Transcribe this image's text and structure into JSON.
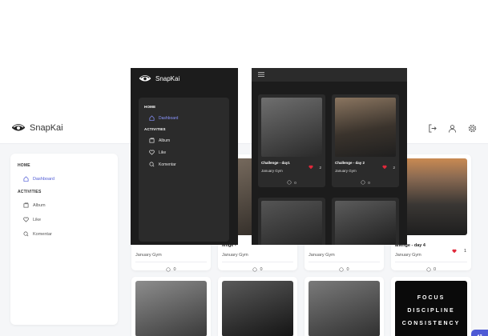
{
  "app": {
    "brand": "SnapKai"
  },
  "sidebar": {
    "home_label": "HOME",
    "dashboard_label": "Dashboard",
    "activities_label": "ACTIVITIES",
    "items": [
      {
        "label": "Album",
        "icon": "album-icon"
      },
      {
        "label": "Like",
        "icon": "heart-icon"
      },
      {
        "label": "Komentar",
        "icon": "comment-icon"
      }
    ]
  },
  "topbar_icons": [
    "logout-icon",
    "user-icon",
    "gear-icon"
  ],
  "posts": [
    {
      "title": "Challenge - day1",
      "author": "January Gym",
      "likes": "2",
      "comments": "0"
    },
    {
      "title": "Challenge - day 2",
      "author": "January Gym",
      "likes": "2",
      "comments": "0"
    },
    {
      "title": "Challenge - day 3",
      "author": "January Gym",
      "likes": "2",
      "comments": "0"
    },
    {
      "title": "Challenge - day 4",
      "author": "January Gym",
      "likes": "1",
      "comments": "0"
    }
  ],
  "visible_titles": {
    "card1": "lenge - ",
    "card4": "allenge - day 4"
  },
  "focus_tile": [
    "FOCUS",
    "DISCIPLINE",
    "CONSISTENCY"
  ],
  "colors": {
    "accent": "#4f5bd5",
    "heart": "#e0283a",
    "dark_bg": "#1c1c1c",
    "dark_panel": "#2b2b2b"
  }
}
